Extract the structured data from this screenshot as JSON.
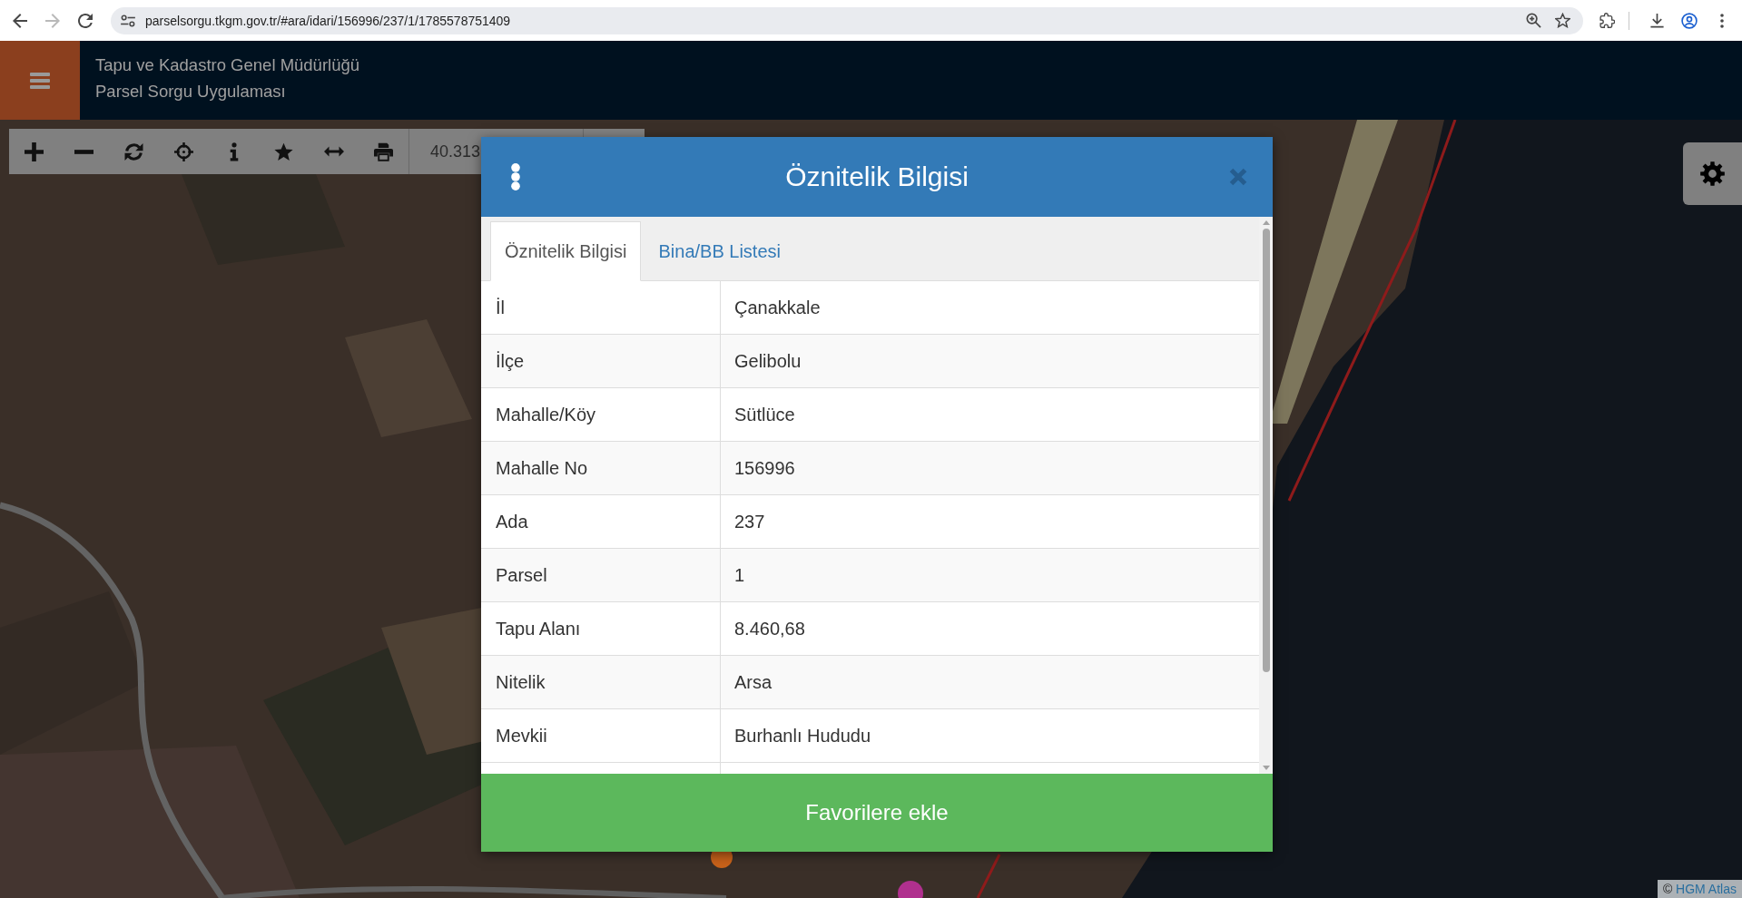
{
  "browser": {
    "nav_buttons": [
      {
        "kind": "back",
        "disabled": false
      },
      {
        "kind": "forward",
        "disabled": true
      },
      {
        "kind": "reload",
        "disabled": false
      }
    ],
    "url": "parselsorgu.tkgm.gov.tr/#ara/idari/156996/237/1/1785578751409"
  },
  "header": {
    "title": "Tapu ve Kadastro Genel Müdürlüğü",
    "subtitle": "Parsel Sorgu Uygulaması"
  },
  "map_toolbar": {
    "tools": [
      {
        "kind": "plus"
      },
      {
        "kind": "minus"
      },
      {
        "kind": "refresh"
      },
      {
        "kind": "crosshair"
      },
      {
        "kind": "info"
      },
      {
        "kind": "star"
      },
      {
        "kind": "arrows"
      },
      {
        "kind": "printer"
      }
    ],
    "coordinate": "40.313"
  },
  "modal": {
    "title": "Öznitelik Bilgisi",
    "tabs": [
      {
        "label": "Öznitelik Bilgisi",
        "selected": true
      },
      {
        "label": "Bina/BB Listesi",
        "selected": false
      }
    ],
    "rows": [
      {
        "label": "İl",
        "value": "Çanakkale"
      },
      {
        "label": "İlçe",
        "value": "Gelibolu"
      },
      {
        "label": "Mahalle/Köy",
        "value": "Sütlüce"
      },
      {
        "label": "Mahalle No",
        "value": "156996"
      },
      {
        "label": "Ada",
        "value": "237"
      },
      {
        "label": "Parsel",
        "value": "1"
      },
      {
        "label": "Tapu Alanı",
        "value": "8.460,68"
      },
      {
        "label": "Nitelik",
        "value": "Arsa"
      },
      {
        "label": "Mevkii",
        "value": "Burhanlı Hududu"
      }
    ],
    "button": "Favorilere ekle"
  },
  "attribution": {
    "prefix": "©",
    "link": "HGM Atlas"
  }
}
